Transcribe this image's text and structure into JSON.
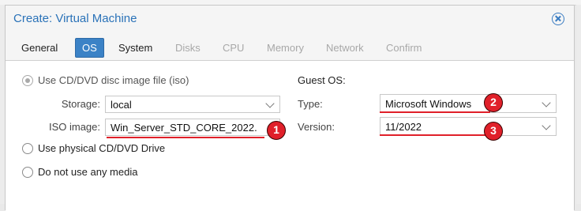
{
  "dialog": {
    "title": "Create: Virtual Machine"
  },
  "tabs": [
    {
      "label": "General",
      "state": "normal"
    },
    {
      "label": "OS",
      "state": "active"
    },
    {
      "label": "System",
      "state": "normal"
    },
    {
      "label": "Disks",
      "state": "disabled"
    },
    {
      "label": "CPU",
      "state": "disabled"
    },
    {
      "label": "Memory",
      "state": "disabled"
    },
    {
      "label": "Network",
      "state": "disabled"
    },
    {
      "label": "Confirm",
      "state": "disabled"
    }
  ],
  "media": {
    "iso_option_label": "Use CD/DVD disc image file (iso)",
    "storage_label": "Storage:",
    "storage_value": "local",
    "iso_image_label": "ISO image:",
    "iso_image_value": "Win_Server_STD_CORE_2022.",
    "physical_option_label": "Use physical CD/DVD Drive",
    "no_media_option_label": "Do not use any media"
  },
  "guest_os": {
    "heading": "Guest OS:",
    "type_label": "Type:",
    "type_value": "Microsoft Windows",
    "version_label": "Version:",
    "version_value": "11/2022"
  },
  "annotations": {
    "badge_1": "1",
    "badge_2": "2",
    "badge_3": "3",
    "color": "#e0202a"
  }
}
